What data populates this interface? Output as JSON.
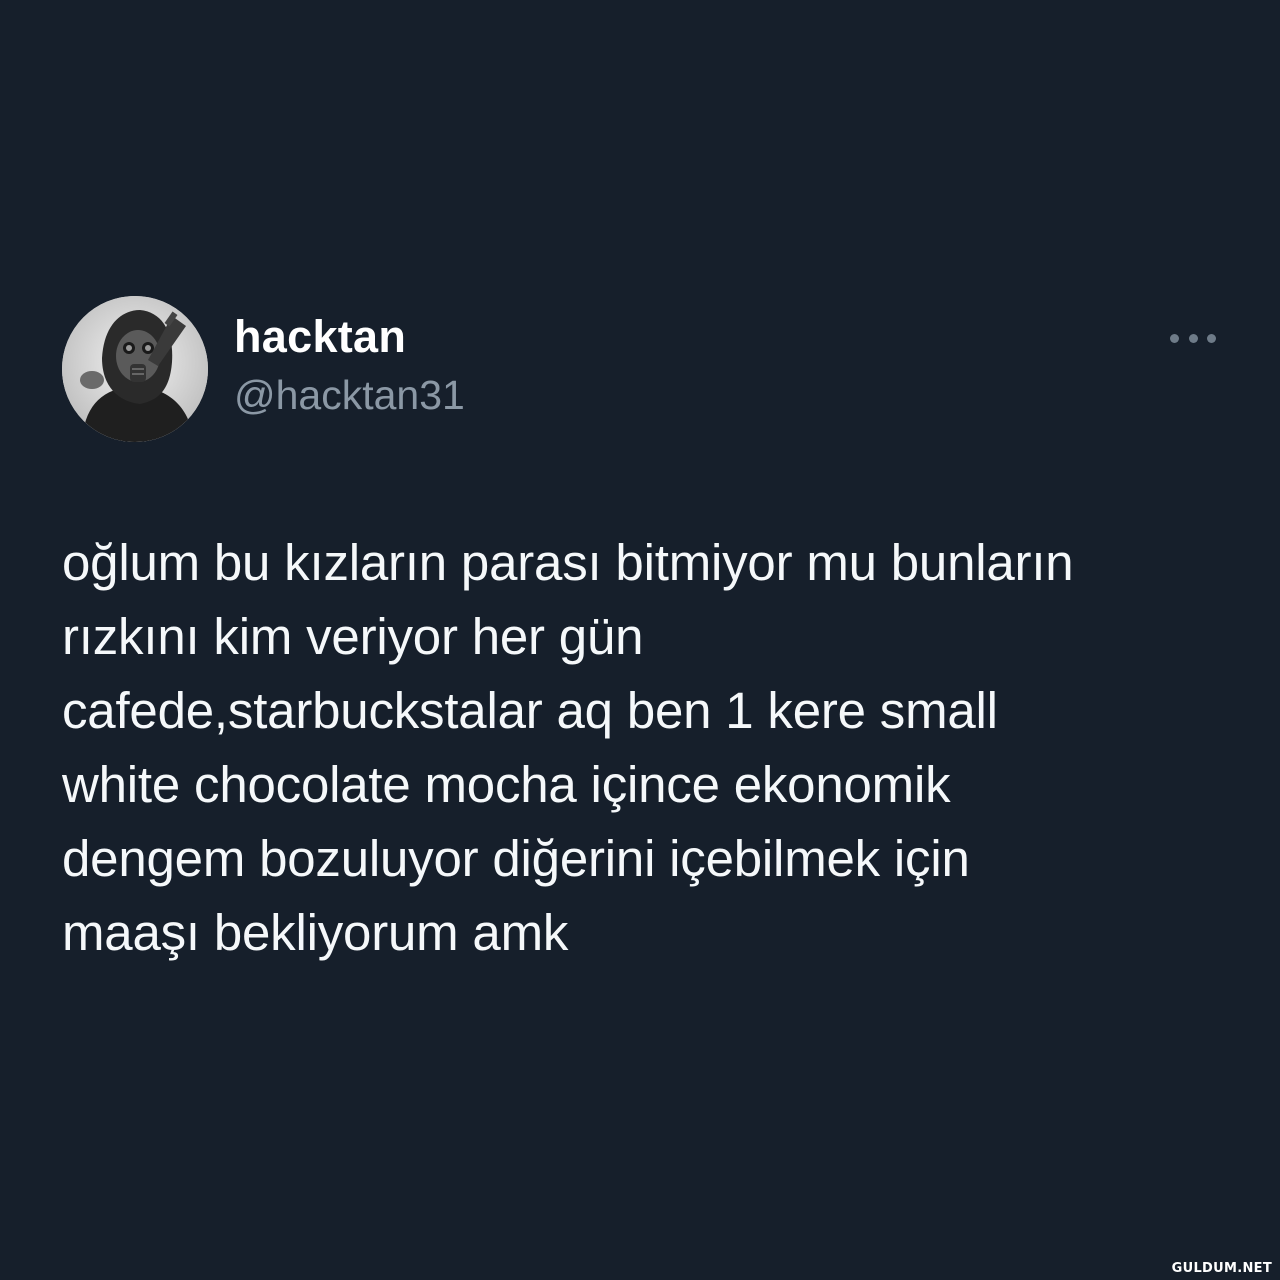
{
  "author": {
    "display_name": "hacktan",
    "handle": "@hacktan31",
    "avatar_icon": "gas-mask-avatar-icon"
  },
  "menu": {
    "more_icon": "more-horizontal-icon"
  },
  "tweet": {
    "text": "oğlum bu kızların parası bitmiyor mu bunların\nrızkını kim veriyor her gün\ncafede,starbuckstalar aq ben 1 kere small\nwhite chocolate mocha içince ekonomik\ndengem bozuluyor diğerini içebilmek için\nmaaşı bekliyorum amk"
  },
  "watermark": {
    "text": "GULDUM.NET"
  },
  "colors": {
    "background": "#161f2b",
    "name": "#ffffff",
    "handle": "#8b98a5",
    "text": "#f5f8fa"
  }
}
